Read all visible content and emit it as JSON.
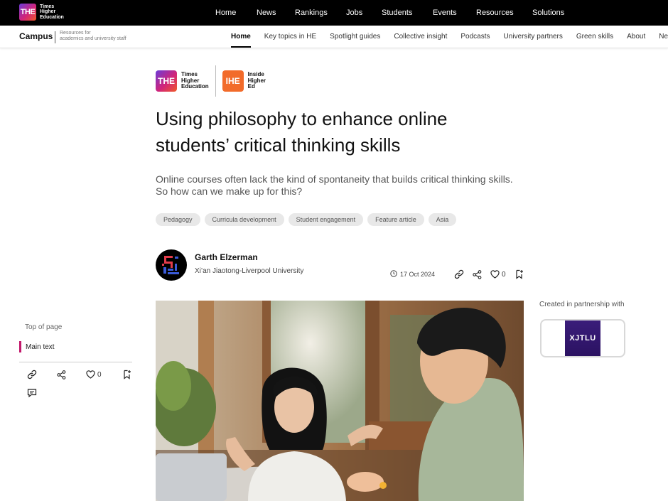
{
  "brand": {
    "mark": "THE",
    "words": [
      "Times",
      "Higher",
      "Education"
    ]
  },
  "topnav": [
    "Home",
    "News",
    "Rankings",
    "Jobs",
    "Students",
    "Events",
    "Resources",
    "Solutions"
  ],
  "subheader": {
    "campus": "Campus",
    "campus_sub_1": "Resources for",
    "campus_sub_2": "academics and university staff",
    "items": [
      "Home",
      "Key topics in HE",
      "Spotlight guides",
      "Collective insight",
      "Podcasts",
      "University partners",
      "Green skills",
      "About",
      "New"
    ],
    "active_index": 0
  },
  "logos": {
    "the_mark": "THE",
    "the_words": [
      "Times",
      "Higher",
      "Education"
    ],
    "ihe_mark": "IHE",
    "ihe_words": [
      "Inside",
      "Higher",
      "Ed"
    ]
  },
  "article": {
    "title": "Using philosophy to enhance online students’ critical thinking skills",
    "standfirst": "Online courses often lack the kind of spontaneity that builds critical thinking skills. So how can we make up for this?",
    "tags": [
      "Pedagogy",
      "Curricula development",
      "Student engagement",
      "Feature article",
      "Asia"
    ],
    "author_name": "Garth Elzerman",
    "author_institution": "Xi’an Jiaotong-Liverpool University",
    "date": "17 Oct 2024",
    "likes": "0"
  },
  "sidebar": {
    "top_of_page": "Top of page",
    "main_text": "Main text",
    "likes": "0"
  },
  "partnership": {
    "label": "Created in partnership with",
    "partner_logo_text": "XJTLU"
  },
  "colors": {
    "accent_magenta": "#c2186b",
    "ihe_orange": "#f26b2a",
    "xjtlu_purple": "#3a1d7a"
  }
}
